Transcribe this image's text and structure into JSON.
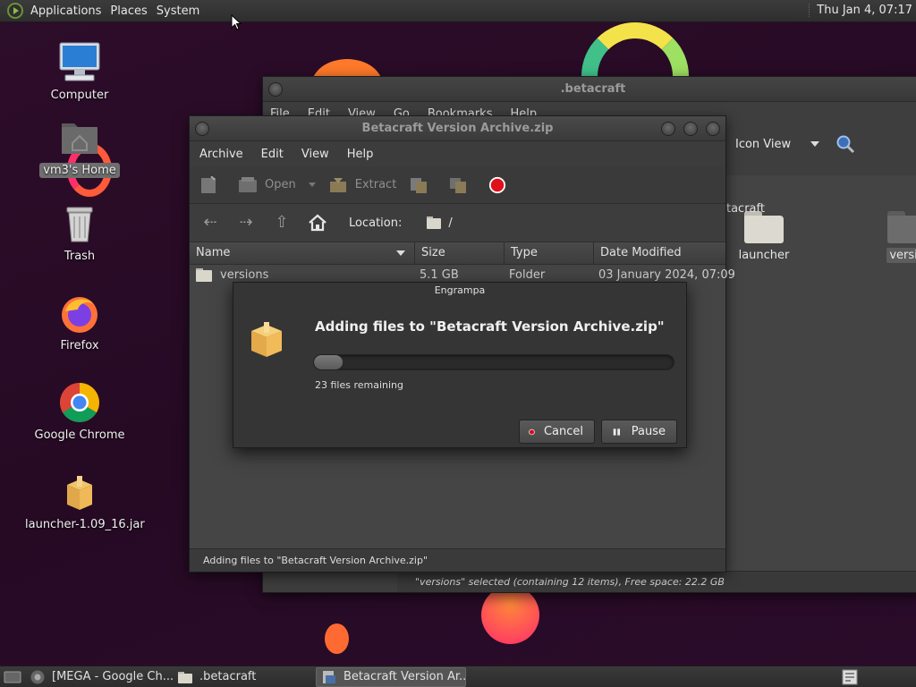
{
  "top_panel": {
    "menus": [
      "Applications",
      "Places",
      "System"
    ],
    "clock": "Thu Jan  4, 07:17"
  },
  "desktop_icons": [
    {
      "label": "Computer",
      "icon": "computer-icon"
    },
    {
      "label": "vm3's Home",
      "icon": "home-folder-icon"
    },
    {
      "label": "Trash",
      "icon": "trash-icon"
    },
    {
      "label": "Firefox",
      "icon": "firefox-icon"
    },
    {
      "label": "Google Chrome",
      "icon": "chrome-icon"
    },
    {
      "label": "launcher-1.09_16.jar",
      "icon": "archive-icon"
    }
  ],
  "file_manager": {
    "title": ".betacraft",
    "menus": [
      "File",
      "Edit",
      "View",
      "Go",
      "Bookmarks",
      "Help"
    ],
    "view_mode": "Icon View",
    "path": "etacraft",
    "folders": [
      {
        "label": "launcher"
      },
      {
        "label": "versio"
      }
    ],
    "status": "\"versions\" selected (containing 12 items), Free space: 22.2 GB"
  },
  "archive_manager": {
    "title": "Betacraft Version Archive.zip",
    "menus": [
      "Archive",
      "Edit",
      "View",
      "Help"
    ],
    "toolbar": {
      "open": "Open",
      "extract": "Extract"
    },
    "location_label": "Location:",
    "location_value": "/",
    "columns": [
      "Name",
      "Size",
      "Type",
      "Date Modified"
    ],
    "rows": [
      {
        "name": "versions",
        "size": "5.1 GB",
        "type": "Folder",
        "modified": "03 January 2024, 07:09"
      }
    ],
    "status": "Adding files to \"Betacraft Version Archive.zip\""
  },
  "progress_dialog": {
    "title": "Engrampa",
    "heading": "Adding files to \"Betacraft Version Archive.zip\"",
    "progress": 0.08,
    "remaining": "23 files remaining",
    "cancel_label": "Cancel",
    "pause_label": "Pause"
  },
  "taskbar": {
    "tasks": [
      {
        "label": "[MEGA - Google Ch...",
        "icon": "chrome-icon"
      },
      {
        "label": ".betacraft",
        "icon": "folder-icon"
      },
      {
        "label": "Betacraft Version Ar...",
        "icon": "archive-manager-icon",
        "active": true
      }
    ]
  },
  "colors": {
    "accent_cancel": "#d0101a",
    "folder": "#d9d7cc",
    "wallpaper": "#2b0d28"
  }
}
